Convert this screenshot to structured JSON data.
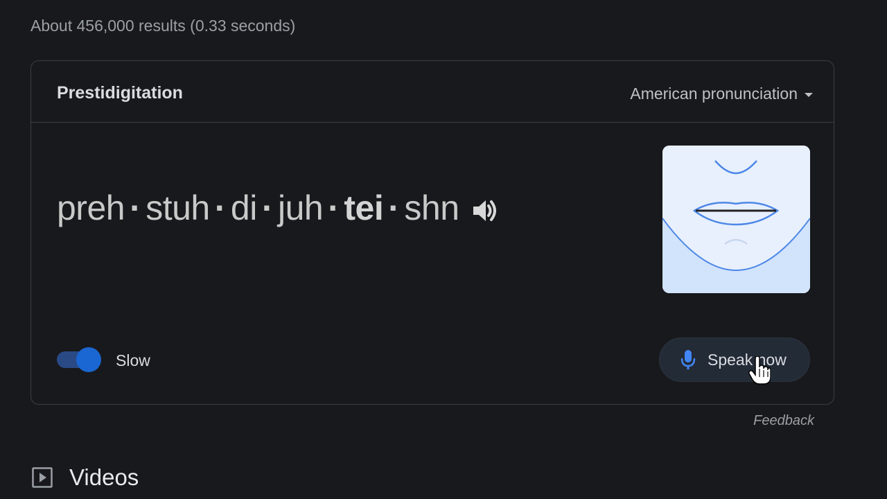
{
  "results": {
    "stats": "About 456,000 results (0.33 seconds)"
  },
  "pronunciation": {
    "title": "Prestidigitation",
    "accent": "American pronunciation",
    "syllables": [
      "preh",
      "stuh",
      "di",
      "juh",
      "tei",
      "shn"
    ],
    "stressed_index": 4,
    "separator": "·",
    "slow_label": "Slow",
    "slow_enabled": true,
    "speak_label": "Speak now",
    "icons": [
      "speaker-icon",
      "mouth-illustration",
      "microphone-icon",
      "hand-cursor-icon",
      "dropdown-caret-icon"
    ]
  },
  "feedback_label": "Feedback",
  "videos": {
    "title": "Videos",
    "icon": "play-icon"
  },
  "colors": {
    "background": "#18191c",
    "toggle_knob": "#1a66d2",
    "mic": "#4285f4",
    "mouth_line": "#4285f4"
  }
}
